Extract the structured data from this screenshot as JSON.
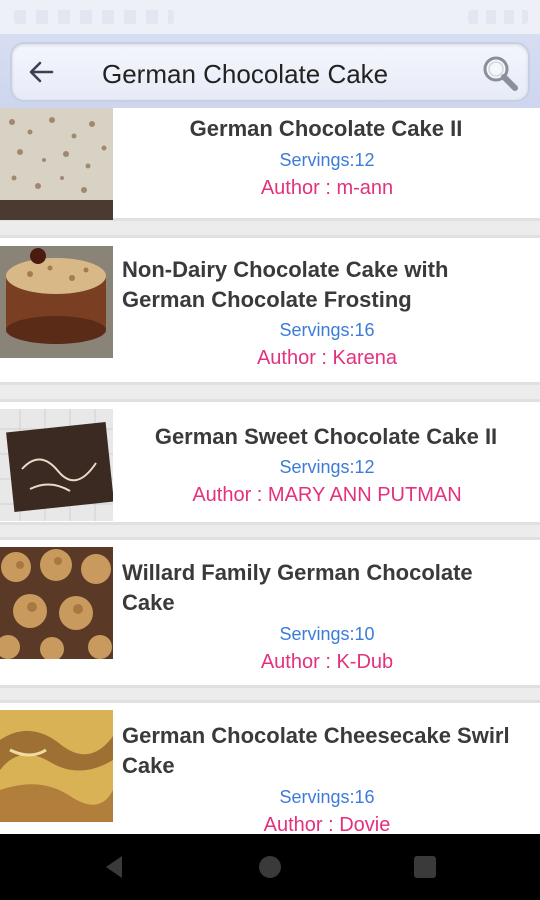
{
  "search": {
    "query": "German Chocolate Cake"
  },
  "icons": {
    "back": "arrow-left-icon",
    "search": "magnifier-icon",
    "nav_back": "triangle-back-icon",
    "nav_home": "circle-home-icon",
    "nav_recents": "square-recents-icon"
  },
  "colors": {
    "servings": "#3d7bd8",
    "author": "#e3317d",
    "title": "#3a3a3a"
  },
  "recipes": [
    {
      "title": "German Chocolate Cake II",
      "servings": "Servings:12",
      "author": "Author : m-ann"
    },
    {
      "title": "Non-Dairy Chocolate Cake with German Chocolate Frosting",
      "servings": "Servings:16",
      "author": "Author : Karena"
    },
    {
      "title": "German Sweet Chocolate Cake II",
      "servings": "Servings:12",
      "author": "Author : MARY ANN PUTMAN"
    },
    {
      "title": "Willard Family German Chocolate Cake",
      "servings": "Servings:10",
      "author": "Author : K-Dub"
    },
    {
      "title": "German Chocolate Cheesecake Swirl Cake",
      "servings": "Servings:16",
      "author": "Author : Dovie"
    }
  ]
}
